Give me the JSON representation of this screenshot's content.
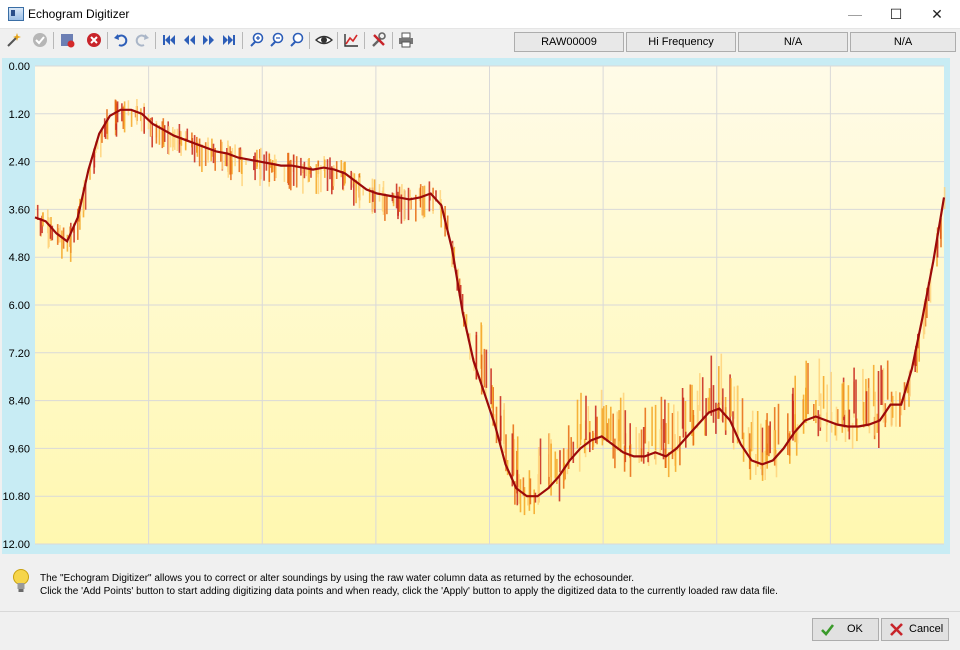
{
  "window": {
    "title": "Echogram Digitizer"
  },
  "toolbar": {
    "status": [
      "RAW00009",
      "Hi Frequency",
      "N/A",
      "N/A"
    ],
    "icons": [
      "wand-icon",
      "check-circle-icon",
      "clear-points-icon",
      "delete-icon",
      "undo-icon",
      "redo-icon",
      "first-icon",
      "previous-icon",
      "next-icon",
      "last-icon",
      "zoom-in-icon",
      "zoom-out-icon",
      "zoom-fit-icon",
      "view-icon",
      "chart-icon",
      "settings-icon",
      "print-icon"
    ]
  },
  "chart_data": {
    "type": "line",
    "ylim": [
      0,
      12
    ],
    "y_inverted": true,
    "y_ticks": [
      "0.00",
      "1.20",
      "2.40",
      "3.60",
      "4.80",
      "6.00",
      "7.20",
      "8.40",
      "9.60",
      "10.80",
      "12.00"
    ],
    "x": [
      0,
      1,
      2,
      3,
      4,
      5,
      6,
      7,
      8,
      9,
      10,
      11,
      12,
      13,
      14,
      15,
      16,
      17,
      18,
      19,
      20,
      21,
      22,
      23,
      24,
      25,
      26,
      27,
      28,
      29,
      30,
      31,
      32,
      33,
      34,
      35,
      36,
      37,
      38,
      39,
      40,
      41,
      42,
      43,
      44,
      45,
      46,
      47,
      48,
      49,
      50,
      51,
      52,
      53,
      54,
      55,
      56,
      57,
      58,
      59,
      60,
      61,
      62,
      63,
      64,
      65,
      66,
      67,
      68,
      69,
      70,
      71,
      72,
      73,
      74,
      75,
      76,
      77,
      78,
      79,
      80
    ],
    "series": [
      {
        "values": [
          3.8,
          3.9,
          4.2,
          4.4,
          3.8,
          2.6,
          1.7,
          1.25,
          1.1,
          1.1,
          1.2,
          1.45,
          1.6,
          1.75,
          1.85,
          1.95,
          2.05,
          2.15,
          2.2,
          2.3,
          2.35,
          2.4,
          2.45,
          2.5,
          2.5,
          2.55,
          2.6,
          2.55,
          2.6,
          2.7,
          2.9,
          3.1,
          3.2,
          3.25,
          3.3,
          3.35,
          3.3,
          3.2,
          3.5,
          4.6,
          6.2,
          7.4,
          8.2,
          9.0,
          10.0,
          10.6,
          10.8,
          10.8,
          10.6,
          10.3,
          9.9,
          9.6,
          9.4,
          9.3,
          9.5,
          9.7,
          9.8,
          9.8,
          9.7,
          9.8,
          9.6,
          9.3,
          9.0,
          8.7,
          8.6,
          8.9,
          9.5,
          9.9,
          10.0,
          9.9,
          9.6,
          9.2,
          8.9,
          8.8,
          8.9,
          9.0,
          9.05,
          9.05,
          9.0,
          8.9,
          8.5
        ]
      }
    ],
    "extra_tail": [
      8.5,
      7.6,
      6.3,
      4.9,
      3.3
    ]
  },
  "info": {
    "line1": "The \"Echogram Digitizer\" allows you to correct or alter soundings by using the raw water column data as returned by the echosounder.",
    "line2": "Click the 'Add Points' button to start adding digitizing data points and when ready, click the 'Apply' button to apply the digitized data to the currently loaded raw data file."
  },
  "buttons": {
    "ok": "OK",
    "cancel": "Cancel"
  },
  "colors": {
    "ok_green": "#3a9a2a",
    "cancel_red": "#c8242a",
    "echo_dark": "#7a1010"
  }
}
